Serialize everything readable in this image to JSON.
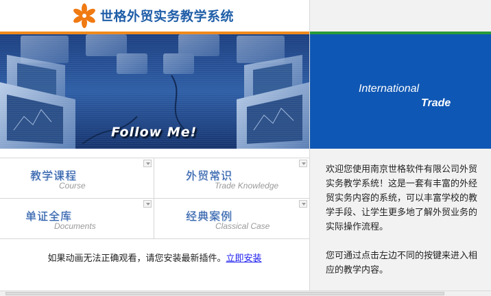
{
  "logo": {
    "title": "世格外贸实务教学系统"
  },
  "banner": {
    "slogan": "Follow Me!"
  },
  "side_banner": {
    "line1": "International",
    "line2": "Trade"
  },
  "menu": [
    {
      "zh": "教学课程",
      "en": "Course"
    },
    {
      "zh": "外贸常识",
      "en": "Trade Knowledge"
    },
    {
      "zh": "单证全库",
      "en": "Documents"
    },
    {
      "zh": "经典案例",
      "en": "Classical Case"
    }
  ],
  "notice": {
    "text": "如果动画无法正确观看，请您安装最新插件。",
    "link": "立即安装"
  },
  "intro": {
    "para1": "欢迎您使用南京世格软件有限公司外贸实务教学系统！这是一套有丰富的外经贸实务内容的系统，可以丰富学校的教学手段、让学生更多地了解外贸业务的实际操作流程。",
    "para2": "您可通过点击左边不同的按键来进入相应的教学内容。"
  },
  "colors": {
    "brand_blue": "#1f5ea8",
    "accent_orange": "#f08a1c",
    "accent_green": "#2a9a3a",
    "panel_blue": "#0f57b4"
  }
}
